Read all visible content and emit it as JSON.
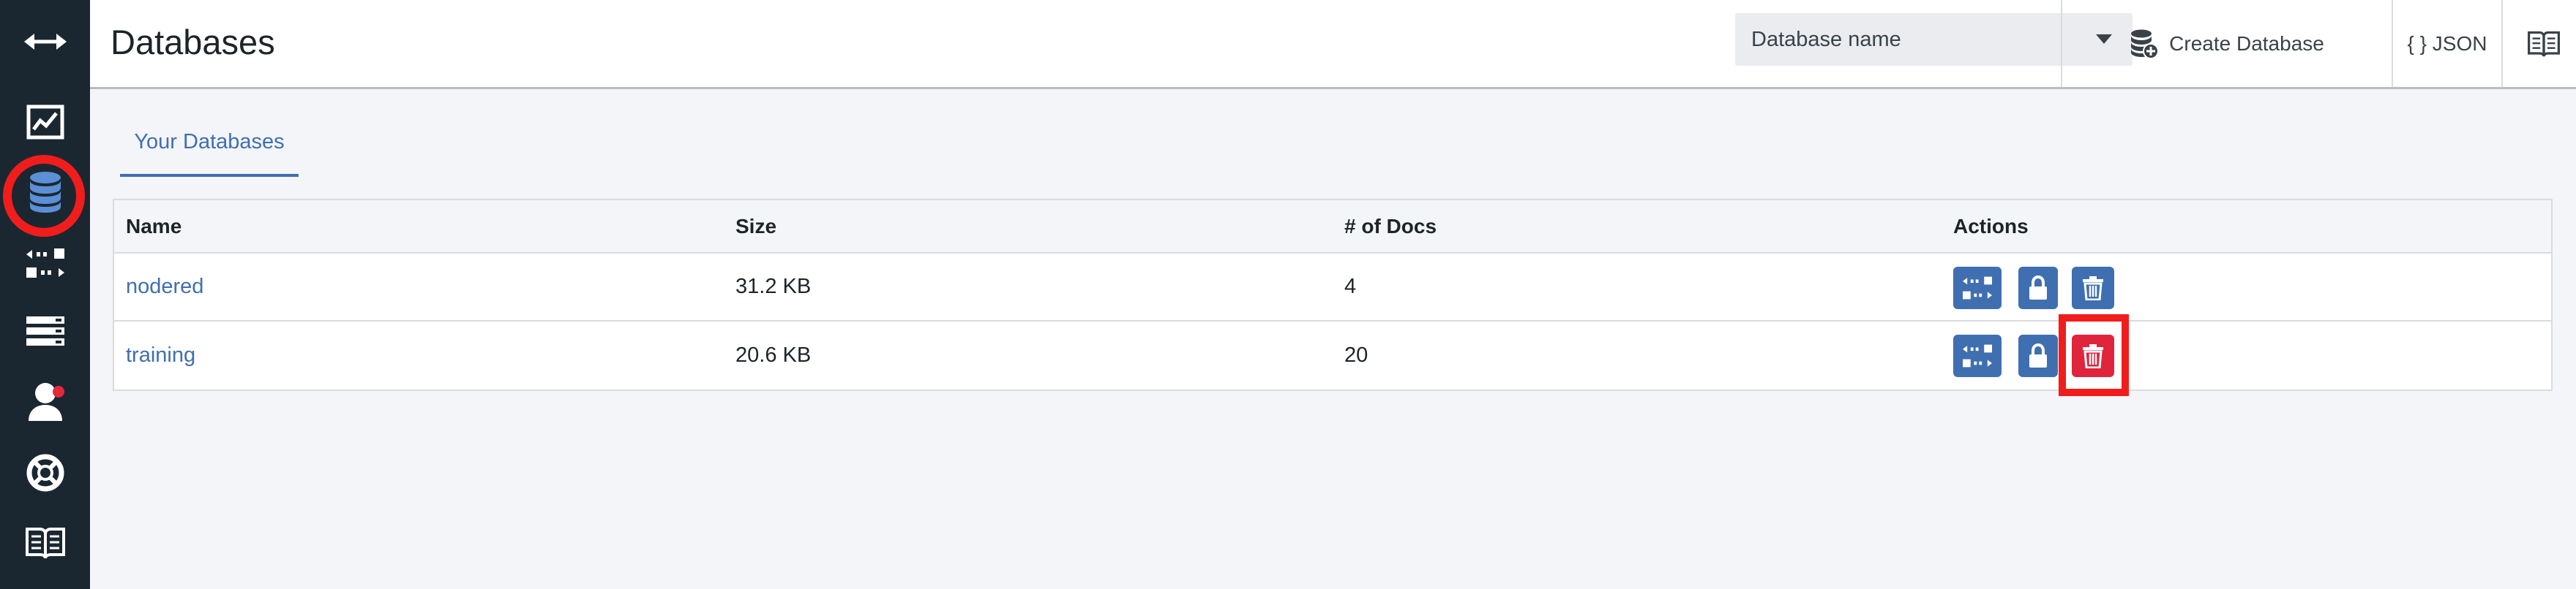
{
  "header": {
    "title": "Databases",
    "db_select": {
      "value": "Database name"
    },
    "create_db_label": "Create Database",
    "json_label": "{ } JSON"
  },
  "tabs": [
    {
      "label": "Your Databases"
    }
  ],
  "table": {
    "columns": [
      "Name",
      "Size",
      "# of Docs",
      "Actions"
    ],
    "rows": [
      {
        "name": "nodered",
        "size": "31.2 KB",
        "docs": "4"
      },
      {
        "name": "training",
        "size": "20.6 KB",
        "docs": "20"
      }
    ]
  },
  "sidebar": {
    "items": [
      {
        "icon": "expand-arrows-icon"
      },
      {
        "icon": "activity-chart-icon"
      },
      {
        "icon": "database-icon",
        "active": true
      },
      {
        "icon": "replication-icon"
      },
      {
        "icon": "server-stack-icon"
      },
      {
        "icon": "user-icon",
        "badge": true
      },
      {
        "icon": "lifebuoy-icon"
      },
      {
        "icon": "documentation-book-icon"
      }
    ]
  },
  "colors": {
    "sidebar_bg": "#1b2730",
    "accent": "#3f6fb0",
    "danger": "#e0243b",
    "highlight": "#f11d1d"
  }
}
